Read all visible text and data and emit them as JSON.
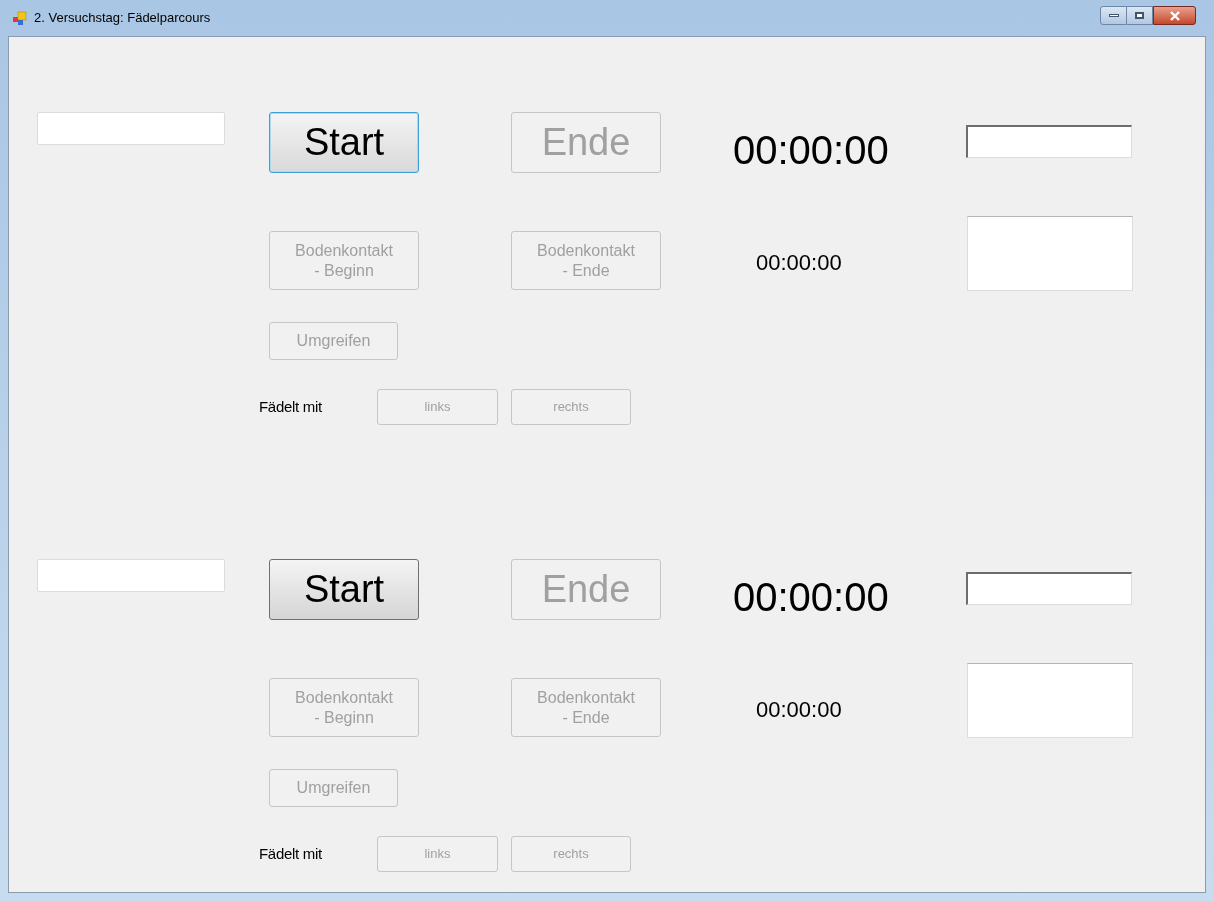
{
  "window": {
    "title": "2. Versuchstag: Fädelparcours"
  },
  "sections": [
    {
      "start": {
        "label": "Start",
        "disabled": false,
        "focused": true
      },
      "end": {
        "label": "Ende",
        "disabled": true
      },
      "timer": "00:00:00",
      "contact_begin": {
        "label": "Bodenkontakt\n- Beginn",
        "disabled": true
      },
      "contact_end": {
        "label": "Bodenkontakt\n- Ende",
        "disabled": true
      },
      "contact_timer": "00:00:00",
      "regrip": {
        "label": "Umgreifen",
        "disabled": true
      },
      "threads_label": "Fädelt mit",
      "left": {
        "label": "links",
        "disabled": true
      },
      "right": {
        "label": "rechts",
        "disabled": true
      }
    },
    {
      "start": {
        "label": "Start",
        "disabled": false,
        "focused": false
      },
      "end": {
        "label": "Ende",
        "disabled": true
      },
      "timer": "00:00:00",
      "contact_begin": {
        "label": "Bodenkontakt\n- Beginn",
        "disabled": true
      },
      "contact_end": {
        "label": "Bodenkontakt\n- Ende",
        "disabled": true
      },
      "contact_timer": "00:00:00",
      "regrip": {
        "label": "Umgreifen",
        "disabled": true
      },
      "threads_label": "Fädelt mit",
      "left": {
        "label": "links",
        "disabled": true
      },
      "right": {
        "label": "rechts",
        "disabled": true
      }
    }
  ]
}
